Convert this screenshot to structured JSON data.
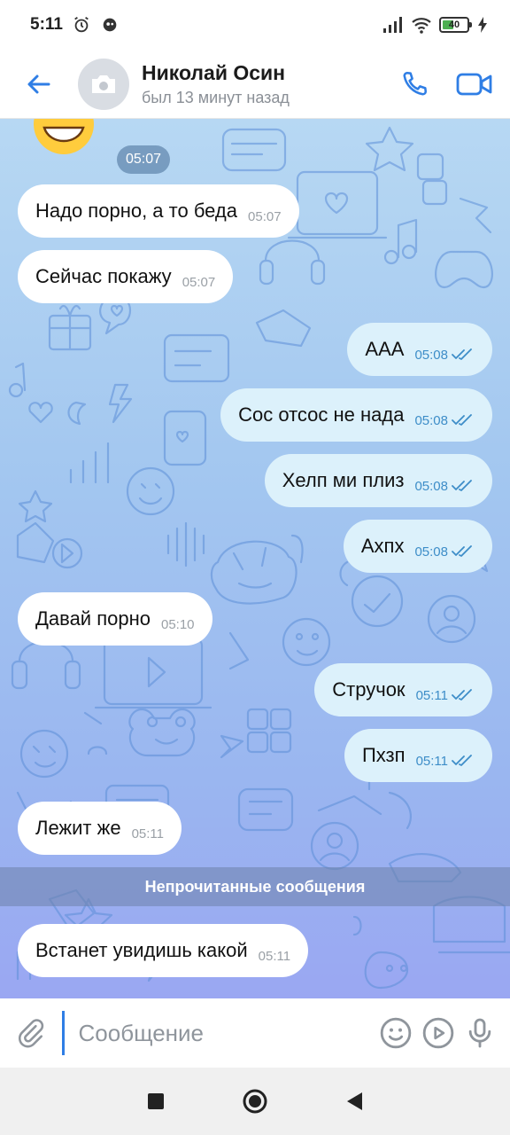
{
  "status_bar": {
    "time": "5:11",
    "battery": "40",
    "icons": [
      "alarm-icon",
      "app-notification-icon",
      "signal-icon",
      "wifi-icon",
      "battery-icon",
      "charging-icon"
    ]
  },
  "header": {
    "back_icon": "arrow-left-icon",
    "name": "Николай Осин",
    "status": "был 13 минут назад",
    "actions": [
      "phone-icon",
      "video-icon"
    ]
  },
  "chat": {
    "date_pill": "05:07",
    "messages": [
      {
        "dir": "in",
        "text": "Надо порно, а то беда",
        "time": "05:07"
      },
      {
        "dir": "in",
        "text": "Сейчас покажу",
        "time": "05:07"
      },
      {
        "dir": "out",
        "text": "ААА",
        "time": "05:08",
        "read": true
      },
      {
        "dir": "out",
        "text": "Сос отсос не нада",
        "time": "05:08",
        "read": true
      },
      {
        "dir": "out",
        "text": "Хелп ми плиз",
        "time": "05:08",
        "read": true
      },
      {
        "dir": "out",
        "text": "Ахпх",
        "time": "05:08",
        "read": true
      },
      {
        "dir": "in",
        "text": "Давай порно",
        "time": "05:10"
      },
      {
        "dir": "out",
        "text": "Стручок",
        "time": "05:11",
        "read": true
      },
      {
        "dir": "out",
        "text": "Пхзп",
        "time": "05:11",
        "read": true
      },
      {
        "dir": "in",
        "text": "Лежит же",
        "time": "05:11"
      },
      {
        "dir": "in",
        "text": "Встанет увидишь какой",
        "time": "05:11"
      }
    ],
    "unread_label": "Непрочитанные сообщения"
  },
  "composer": {
    "placeholder": "Сообщение",
    "value": "",
    "icons": [
      "attach-icon",
      "emoji-icon",
      "send-video-icon",
      "microphone-icon"
    ]
  },
  "colors": {
    "accent": "#2f7ee5",
    "outgoing_bubble": "#dcf1fb",
    "incoming_bubble": "#ffffff"
  }
}
